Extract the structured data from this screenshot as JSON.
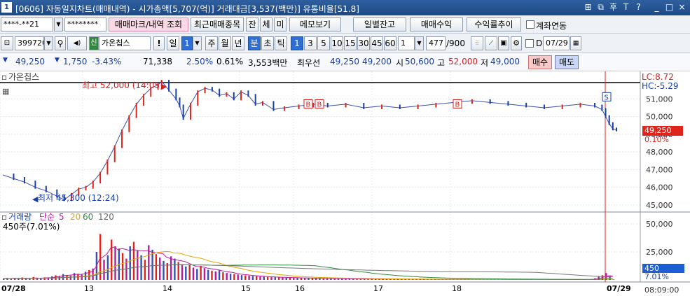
{
  "window": {
    "badge": "1",
    "title": "[0606] 자동일지차트(매매내역) - 시가총액[5,707(억)] 거래대금[3,537(백만)] 유통비율[51.8]",
    "controls": [
      "⊞",
      "⧉",
      "후",
      "T",
      "?",
      "_",
      "□",
      "×"
    ]
  },
  "toolbar1": {
    "account": "****-**21",
    "password": "********",
    "btn_trade_mark": "매매마크/내역 조회",
    "btn_recent": "최근매매종목",
    "btn_jan": "잔",
    "btn_che": "체",
    "btn_mi": "미",
    "btn_memo": "메모보기",
    "btn_daily_balance": "일별잔고",
    "btn_trade_profit": "매매수익",
    "btn_yield_trend": "수익률추이",
    "chk_account_link": "계좌연동"
  },
  "toolbar2": {
    "code": "399720",
    "badge_new": "신",
    "stock_name": "가온칩스",
    "excl": "!",
    "period_day": "일",
    "period_num": "1",
    "tabs": [
      "주",
      "월",
      "년",
      "분",
      "초",
      "틱"
    ],
    "intervals": [
      "1",
      "3",
      "5",
      "10",
      "15",
      "30",
      "45",
      "60"
    ],
    "count_value": "1",
    "range": "477",
    "range_total": "/900",
    "d_label": "D",
    "date": "07/29"
  },
  "quote": {
    "price": "49,250",
    "change": "1,750",
    "change_pct": "-3.43%",
    "volume": "71,338",
    "vol_pct": "2.50%",
    "turnover": "0.61%",
    "amount": "3,553백만",
    "best_ask_label": "최우선",
    "best_ask": "49,250",
    "best_bid": "49,200",
    "open_label": "시",
    "open": "50,600",
    "high_label": "고",
    "high": "52,000",
    "low_label": "저",
    "low": "49,000",
    "buy_btn": "매수",
    "sell_btn": "매도"
  },
  "chart_data": {
    "type": "line",
    "legend_price": "가온칩스",
    "lc_label": "LC:8.72",
    "hc_label": "HC:-5.29",
    "max_annotation": "최고 52,000 (14:05)",
    "min_annotation": "최저 45,300 (12:24)",
    "y_ticks": [
      "51,000",
      "50,000",
      "49,000",
      "48,000",
      "47,000",
      "46,000",
      "45,000"
    ],
    "ylim": [
      44800,
      52400
    ],
    "current_price": "49,250",
    "current_pct": "0.10%",
    "x_labels": [
      "07/28",
      "13",
      "14",
      "15",
      "16",
      "17",
      "18",
      "07/29"
    ],
    "x_time": "08:09:00",
    "markers": [
      "B",
      "B",
      "B",
      "S"
    ],
    "price_series": [
      [
        0,
        46700
      ],
      [
        3,
        46500
      ],
      [
        6,
        46300
      ],
      [
        9,
        46000
      ],
      [
        12,
        45800
      ],
      [
        15,
        45500
      ],
      [
        17,
        45300
      ],
      [
        19,
        45600
      ],
      [
        21,
        45900
      ],
      [
        23,
        46000
      ],
      [
        25,
        46300
      ],
      [
        27,
        46800
      ],
      [
        29,
        47500
      ],
      [
        31,
        48300
      ],
      [
        33,
        49200
      ],
      [
        35,
        50000
      ],
      [
        37,
        50700
      ],
      [
        39,
        51200
      ],
      [
        41,
        51600
      ],
      [
        43,
        51800
      ],
      [
        44,
        52000
      ],
      [
        46,
        51500
      ],
      [
        48,
        51000
      ],
      [
        49,
        50600
      ],
      [
        50,
        49900
      ],
      [
        52,
        50700
      ],
      [
        54,
        51400
      ],
      [
        56,
        51600
      ],
      [
        58,
        51500
      ],
      [
        60,
        51200
      ],
      [
        62,
        51300
      ],
      [
        64,
        51000
      ],
      [
        66,
        51400
      ],
      [
        68,
        51200
      ],
      [
        70,
        50700
      ],
      [
        72,
        50800
      ],
      [
        75,
        50400
      ],
      [
        78,
        50500
      ],
      [
        82,
        50600
      ],
      [
        86,
        50700
      ],
      [
        90,
        50600
      ],
      [
        95,
        50700
      ],
      [
        100,
        50500
      ],
      [
        105,
        50600
      ],
      [
        110,
        50500
      ],
      [
        115,
        50600
      ],
      [
        120,
        50700
      ],
      [
        125,
        50800
      ],
      [
        130,
        50900
      ],
      [
        135,
        50800
      ],
      [
        140,
        50700
      ],
      [
        145,
        50600
      ],
      [
        150,
        50500
      ],
      [
        155,
        50600
      ],
      [
        160,
        50700
      ],
      [
        164,
        50600
      ],
      [
        166,
        50400
      ],
      [
        167,
        50000
      ],
      [
        168,
        49600
      ],
      [
        169,
        49300
      ],
      [
        170,
        49250
      ]
    ],
    "volume_legend": {
      "label": "거래량",
      "ma_label": "단순",
      "periods": [
        "5",
        "20",
        "60",
        "120"
      ]
    },
    "volume_y_ticks": [
      "50,000",
      "25,000"
    ],
    "volume_ylim": [
      0,
      55000
    ],
    "current_volume": "450",
    "current_volume_label": "450주(7.01%)",
    "current_volume_pct": "7.01%",
    "volume_series": [
      1200,
      1500,
      900,
      1800,
      1100,
      2200,
      1400,
      900,
      2600,
      1700,
      1300,
      2100,
      1600,
      3200,
      4100,
      3500,
      5200,
      4400,
      3900,
      6100,
      5500,
      4700,
      7300,
      8800,
      10200,
      25000,
      41000,
      18000,
      22000,
      36000,
      30000,
      28000,
      24000,
      19000,
      30000,
      34000,
      26000,
      22000,
      18000,
      31000,
      27000,
      23000,
      20000,
      17000,
      15000,
      21000,
      19000,
      16000,
      14000,
      12000,
      13500,
      11000,
      9800,
      12500,
      10500,
      9000,
      8200,
      7600,
      9100,
      6800,
      6100,
      5500,
      5200,
      4800,
      4300,
      4000,
      3800,
      3500,
      3300,
      3000,
      2800,
      2600,
      2500,
      2400,
      2300,
      2200,
      2100,
      2000,
      1900,
      1800,
      1700,
      1600,
      1600,
      1500,
      1400,
      1400,
      1300,
      1300,
      1200,
      1200,
      1100,
      1100,
      1000,
      1000,
      950,
      900,
      900,
      850,
      800,
      800,
      780,
      760,
      740,
      720,
      700,
      700,
      680,
      660,
      640,
      620,
      600,
      600,
      580,
      560,
      540,
      520,
      520,
      500,
      500,
      480,
      480,
      460,
      460,
      450,
      450,
      440,
      440,
      430,
      430,
      420,
      420,
      410,
      410,
      400,
      400,
      400,
      390,
      390,
      380,
      380,
      370,
      370,
      360,
      360,
      350,
      350,
      350,
      340,
      340,
      330,
      330,
      320,
      320,
      310,
      310,
      300,
      300,
      300,
      300,
      1500,
      2800,
      4200,
      6100,
      3900,
      450
    ]
  }
}
